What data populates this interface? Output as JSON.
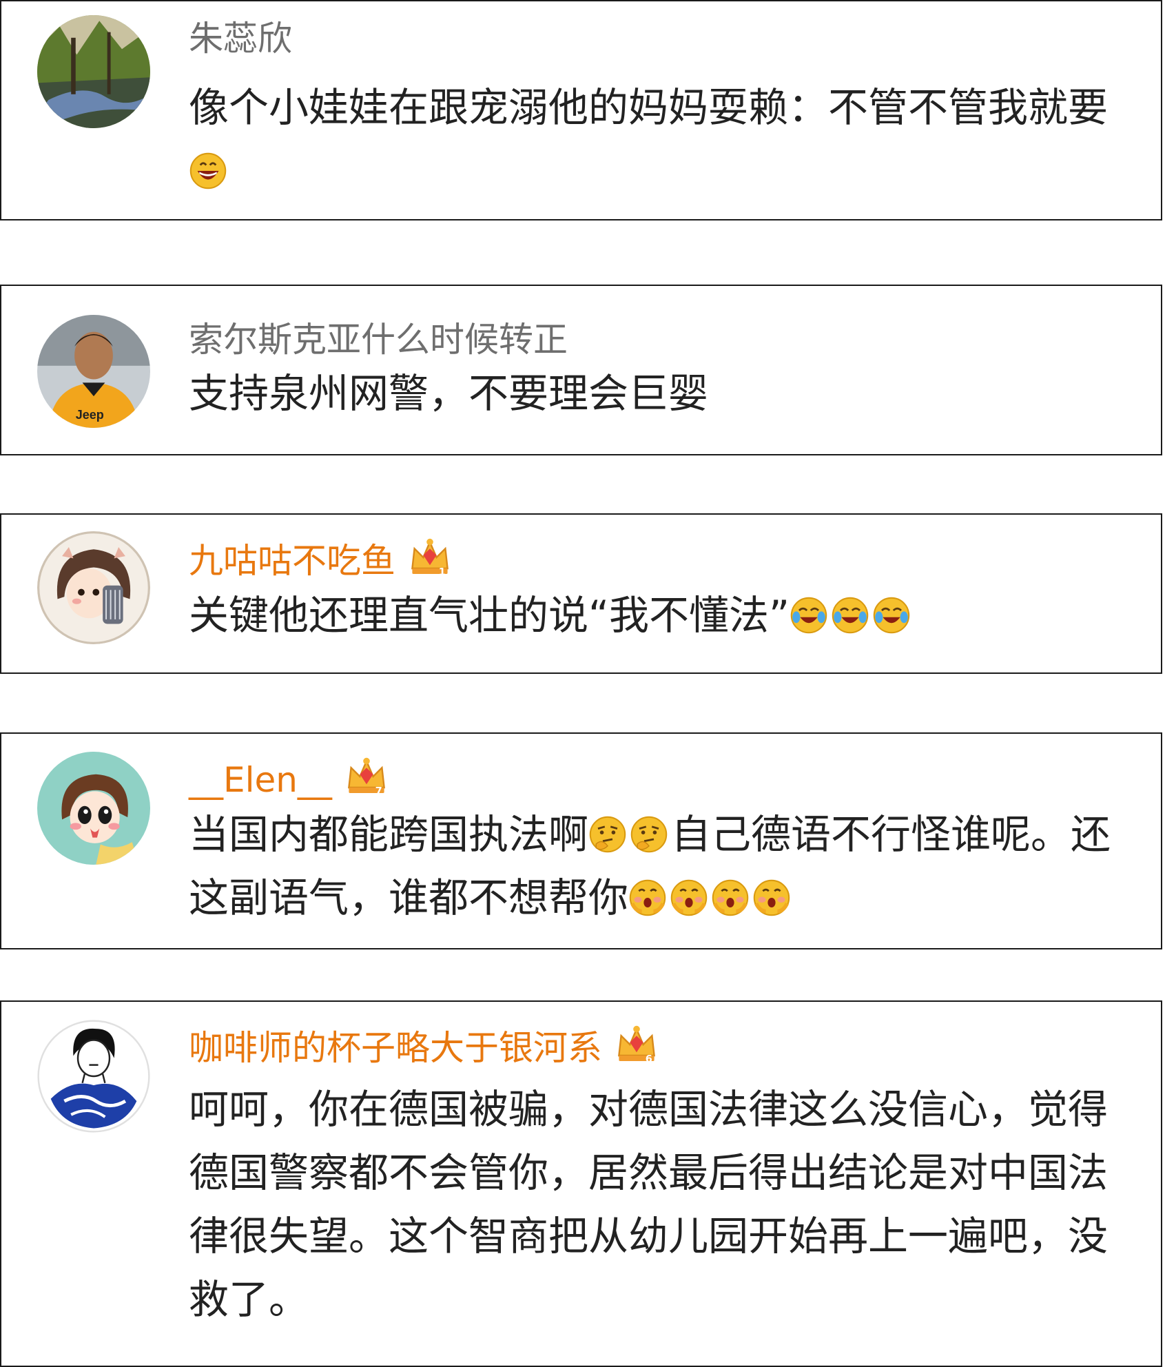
{
  "comments": [
    {
      "username": "朱蕊欣",
      "text": "像个小娃娃在跟宠溺他的妈妈耍赖：不管不管我就要",
      "emojis": [
        "grin-emoji"
      ]
    },
    {
      "username": "索尔斯克亚什么时候转正",
      "text": "支持泉州网警，不要理会巨婴",
      "emojis": []
    },
    {
      "username": "九咕咕不吃鱼",
      "text": "关键他还理直气壮的说“我不懂法”",
      "emojis": [
        "laugh-cry-emoji",
        "laugh-cry-emoji",
        "laugh-cry-emoji"
      ],
      "badge_level": "1"
    },
    {
      "username": "__Elen__",
      "text_part1": "当国内都能跨国执法啊",
      "emojis_mid": [
        "thinking-emoji",
        "thinking-emoji"
      ],
      "text_part2": "自己德语不行怪谁呢。还这副语气，谁都不想帮你",
      "emojis": [
        "shocked-emoji",
        "shocked-emoji",
        "shocked-emoji",
        "shocked-emoji"
      ],
      "badge_level": "7"
    },
    {
      "username": "咖啡师的杯子略大于银河系",
      "text": "呵呵，你在德国被骗，对德国法律这么没信心，觉得德国警察都不会管你，居然最后得出结论是对中国法律很失望。这个智商把从幼儿园开始再上一遍吧，没救了。",
      "emojis": [],
      "badge_level": "6"
    }
  ],
  "colors": {
    "username_default": "#6e6e6e",
    "username_vip": "#e8780f",
    "text": "#222222",
    "border": "#1a1a1a"
  }
}
